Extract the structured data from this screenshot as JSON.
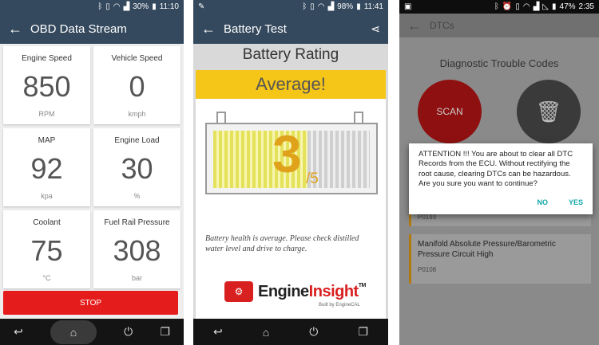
{
  "screen1": {
    "status": {
      "battery": "30%",
      "time": "11:10"
    },
    "title": "OBD Data Stream",
    "cards": [
      {
        "label": "Engine Speed",
        "value": "850",
        "unit": "RPM"
      },
      {
        "label": "Vehicle Speed",
        "value": "0",
        "unit": "kmph"
      },
      {
        "label": "MAP",
        "value": "92",
        "unit": "kpa"
      },
      {
        "label": "Engine Load",
        "value": "30",
        "unit": "%"
      },
      {
        "label": "Coolant",
        "value": "75",
        "unit": "°C"
      },
      {
        "label": "Fuel Rail Pressure",
        "value": "308",
        "unit": "bar"
      }
    ],
    "stop_label": "STOP"
  },
  "screen2": {
    "status": {
      "battery": "98%",
      "time": "11:41"
    },
    "title": "Battery Test",
    "rating_title": "Battery Rating",
    "rating_word": "Average!",
    "score": "3",
    "score_max": "/5",
    "score_fraction": 0.6,
    "note": "Battery health is average. Please check distilled water level and drive to charge.",
    "brand": {
      "engine": "Engine",
      "insight": "Insight",
      "tm": "TM",
      "sub": "Built by EngineCAL"
    }
  },
  "screen3": {
    "status": {
      "battery": "47%",
      "time": "2:35"
    },
    "title": "DTCs",
    "header": "Diagnostic Trouble Codes",
    "scan_label": "SCAN",
    "clear_label": "CLEAR",
    "dialog": {
      "message": "ATTENTION !!! You are about to clear all DTC Records from the ECU. Without rectifying the root cause, clearing DTCs can be hazardous. Are you sure you want to continue?",
      "no": "NO",
      "yes": "YES"
    },
    "items": [
      {
        "code": "P0193"
      },
      {
        "desc": "Manifold Absolute Pressure/Barometric Pressure Circuit High",
        "code": "P0108"
      }
    ]
  }
}
